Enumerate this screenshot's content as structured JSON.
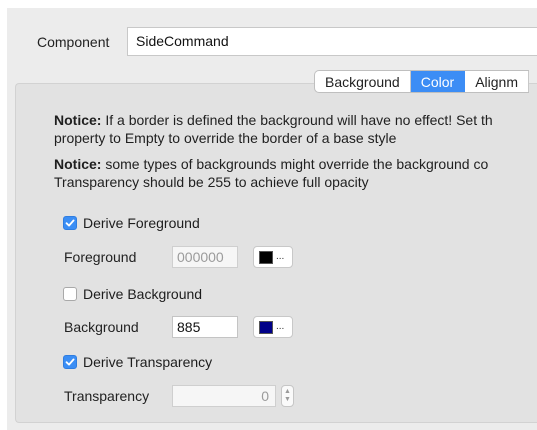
{
  "component": {
    "label": "Component",
    "value": "SideCommand"
  },
  "tabs": [
    {
      "label": "Background",
      "active": false
    },
    {
      "label": "Color",
      "active": true
    },
    {
      "label": "Alignm",
      "active": false
    }
  ],
  "notices": [
    {
      "bold": "Notice:",
      "line1": " If a border is defined the background will have no effect! Set th",
      "line2": "property to Empty to override the border of a base style"
    },
    {
      "bold": "Notice:",
      "line1": " some types of backgrounds might override the background co",
      "line2": "Transparency should be 255 to achieve full opacity"
    }
  ],
  "derive_foreground": {
    "label": "Derive Foreground",
    "checked": true
  },
  "foreground": {
    "label": "Foreground",
    "value": "000000",
    "swatch_color": "#000000",
    "button_label": "..."
  },
  "derive_background": {
    "label": "Derive Background",
    "checked": false
  },
  "background": {
    "label": "Background",
    "value": "885",
    "swatch_color": "#000088",
    "button_label": "..."
  },
  "derive_transparency": {
    "label": "Derive Transparency",
    "checked": true
  },
  "transparency": {
    "label": "Transparency",
    "value": "0"
  },
  "colors": {
    "accent": "#3c8df5",
    "panel": "#e2e2e2"
  }
}
